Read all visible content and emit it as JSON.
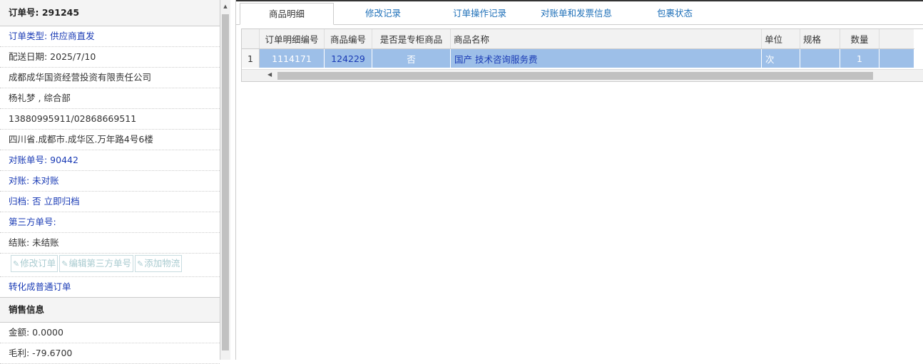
{
  "order": {
    "number_label": "订单号: 291245",
    "type": "订单类型: 供应商直发",
    "delivery_date": "配送日期: 2025/7/10",
    "company": "成都成华国资经营投资有限责任公司",
    "contact": "杨礼梦 , 综合部",
    "phones": "13880995911/02868669511",
    "address": "四川省.成都市.成华区.万年路4号6楼",
    "statement_no": "对账单号: 90442",
    "reconcile": "对账: 未对账",
    "archive": "归档: 否 立即归档",
    "third_party": "第三方单号:",
    "settlement": "结账: 未结账",
    "btn_modify": "修改订单",
    "btn_edit_third": "编辑第三方单号",
    "btn_add_logistics": "添加物流",
    "convert": "转化成普通订单"
  },
  "sales": {
    "header": "销售信息",
    "amount": "金额: 0.0000",
    "profit": "毛利: -79.6700"
  },
  "tabs": [
    "商品明细",
    "修改记录",
    "订单操作记录",
    "对账单和发票信息",
    "包裹状态"
  ],
  "grid": {
    "columns": [
      "订单明细编号",
      "商品编号",
      "是否是专柜商品",
      "商品名称",
      "单位",
      "规格",
      "数量"
    ],
    "rows": [
      {
        "rownum": "1",
        "detail_id": "1114171",
        "product_id": "124229",
        "counter": "否",
        "name": "国产 技术咨询服务费",
        "unit": "次",
        "spec": "",
        "qty": "1"
      }
    ]
  },
  "colors": {
    "selected_row": "#9dbfe8",
    "link_blue": "#1a3bb5",
    "tab_blue": "#1d6fb8"
  },
  "icons": {
    "edit": "edit-icon"
  }
}
